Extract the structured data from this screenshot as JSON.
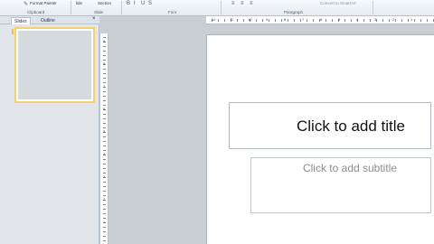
{
  "ribbon": {
    "format_painter": "Format Painter",
    "clipboard_label": "Clipboard",
    "slide_label": "Slide",
    "slides_button": "lide",
    "section_button": "Section",
    "font_label": "Font",
    "paragraph_label": "Paragraph",
    "convert_smartart": "Convert to SmartArt"
  },
  "pane": {
    "tab_slides": "Slides",
    "tab_outline": "Outline",
    "close": "×"
  },
  "slide": {
    "title_placeholder": "Click to add title",
    "subtitle_placeholder": "Click to add subtitle"
  },
  "ruler": {
    "h_numbers": [
      "12",
      "11",
      "10",
      "9",
      "8",
      "7",
      "6",
      "5",
      "4",
      "3",
      "2",
      "1"
    ],
    "v_numbers": [
      "9",
      "8",
      "7",
      "6",
      "5",
      "4",
      "3",
      "2",
      "1"
    ]
  }
}
